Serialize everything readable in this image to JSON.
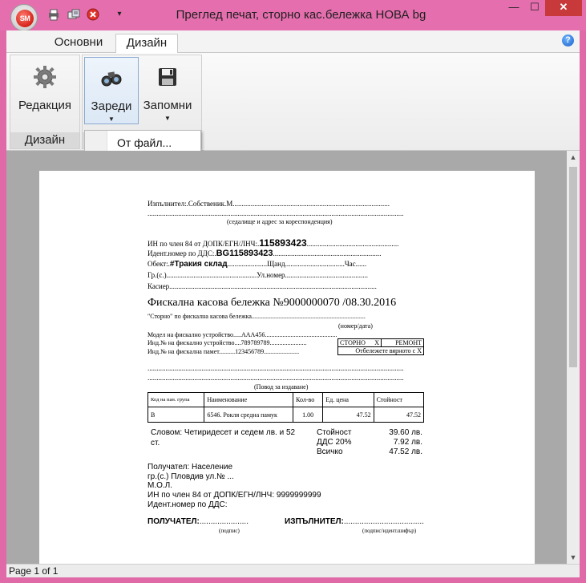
{
  "window": {
    "title": "Преглед печат, сторно кас.бележка НОВА bg",
    "orb_text": "SM",
    "min": "—",
    "max": "☐",
    "close": "✕"
  },
  "ribbon": {
    "tabs": [
      "Основни",
      "Дизайн"
    ],
    "groups": [
      {
        "label": "Дизайн",
        "buttons": [
          "Редакция"
        ]
      },
      {
        "buttons": [
          "Зареди",
          "Запомни"
        ]
      }
    ],
    "dropdown_item": "От файл...",
    "help": "?"
  },
  "status": {
    "page": "Page 1 of 1"
  },
  "receipt": {
    "executor_line": "Изпълнител:.Собственик.М.......................................................................................",
    "dots_line": "..............................................................................................................................................",
    "address_caption": "(седалище и адрес за кореспонденция)",
    "vat84_label": "ИН по член 84 от ДОПК/ЕГН/ЛНЧ:.",
    "vat84_value": "115893423",
    "vat84_dots": "...................................................",
    "vatno_label": "Идент.номер по ДДС:.",
    "vatno_value": "BG115893423",
    "vatno_dots": "............................................................",
    "object_label": "Обект:.",
    "object_value": "#Тракия склад",
    "object_rest": "......................Щанд.................................Час......",
    "city_line": "Гр.(с.)..................................................Ул.номер..............................................",
    "cashier_line": "Касиер...................................................................................................................",
    "heading": "Фискална касова бележка №9000000070  /08.30.2016",
    "storno_line": "\"Сторно\" по фискална касова бележка.......................................................................",
    "number_date_caption": "(номер/дата)",
    "model_line": "Модел на фискално устройство.....AAA456.............................................",
    "device_no_label": "Инд.№ на фискално устройство....",
    "device_no_value": "789789789",
    "device_no_dots": ".......................",
    "memory_no_label": "Инд.№ на фискална памет..........",
    "memory_no_value": "123456789",
    "memory_no_dots": "......................",
    "storno_box": "СТОРНО",
    "storno_x": "Х",
    "repair_box": "РЕМОНТ",
    "mark_box": "Отбележете вярното с Х",
    "reason_caption": "(Повод за издаване)",
    "table_headers": [
      "Код на пан. група",
      "Наименование",
      "Кол-во",
      "Ед. цена",
      "Стойност"
    ],
    "table_rows": [
      [
        "В",
        "6546. Рокля средна памук",
        "1.00",
        "47.52",
        "47.52"
      ]
    ],
    "words_line1": "Словом: Четиридесет и седем лв. и 52",
    "words_line2": "ст.",
    "totals": [
      {
        "label": "Стойност",
        "value": "39.60 лв."
      },
      {
        "label": "ДДС 20%",
        "value": "7.92 лв."
      },
      {
        "label": "Всичко",
        "value": "47.52 лв."
      }
    ],
    "recipient": "Получател: Население",
    "recipient_city": "гр.(с.) Пловдив ул.№ ...",
    "mol": "М.О.Л.",
    "recipient_vat84": "ИН по член 84 от ДОПК/ЕГН/ЛНЧ: 9999999999",
    "recipient_vatno": "Идент.номер по ДДС:",
    "sign_receiver": "ПОЛУЧАТЕЛ:",
    "sign_receiver_dots": "......................",
    "sign_executor": "ИЗПЪЛНИТЕЛ:",
    "sign_executor_dots": "....................................",
    "sign_caption_1": "(подпис)",
    "sign_caption_2": "(подпис/идент.шифър)"
  }
}
